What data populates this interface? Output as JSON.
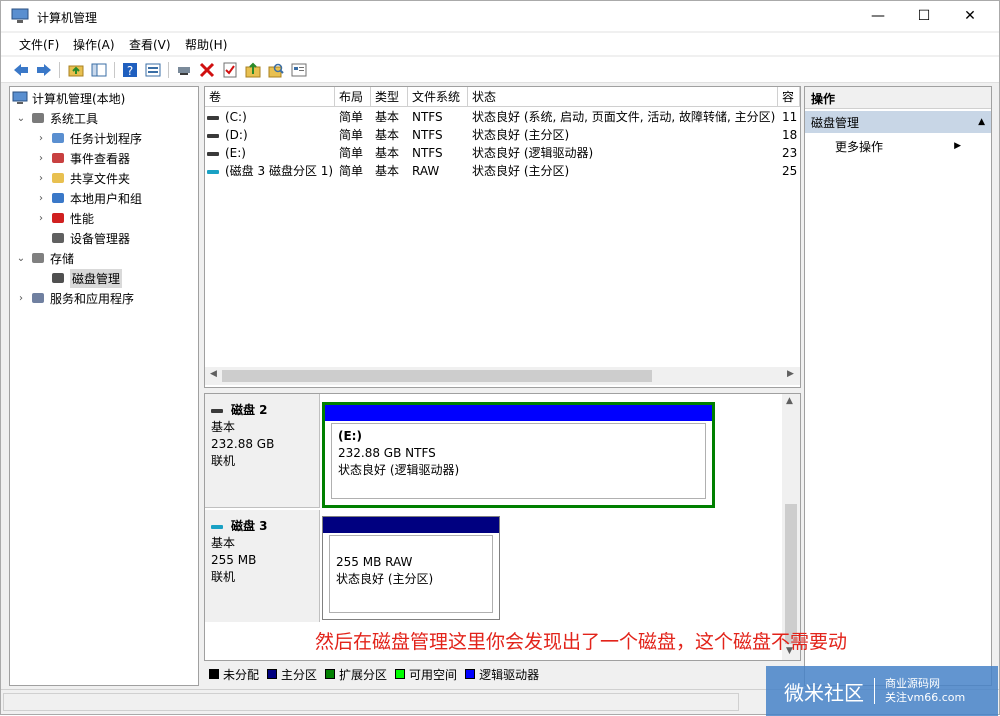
{
  "window": {
    "title": "计算机管理",
    "controls": {
      "minimize": "—",
      "maximize": "☐",
      "close": "✕"
    }
  },
  "menu": [
    "文件(F)",
    "操作(A)",
    "查看(V)",
    "帮助(H)"
  ],
  "toolbar": [
    "back-icon",
    "forward-icon",
    "up-folder-icon",
    "show-tree-icon",
    "help-icon",
    "properties-icon",
    "connect-icon",
    "delete-icon",
    "check-icon",
    "open-folder-icon",
    "search-folder-icon",
    "console-icon"
  ],
  "tree": {
    "root": "计算机管理(本地)",
    "items": [
      {
        "label": "系统工具",
        "level": 1,
        "expander": "⌄",
        "icon": "tools-icon"
      },
      {
        "label": "任务计划程序",
        "level": 2,
        "expander": "›",
        "icon": "clock-icon"
      },
      {
        "label": "事件查看器",
        "level": 2,
        "expander": "›",
        "icon": "event-viewer-icon"
      },
      {
        "label": "共享文件夹",
        "level": 2,
        "expander": "›",
        "icon": "shared-folder-icon"
      },
      {
        "label": "本地用户和组",
        "level": 2,
        "expander": "›",
        "icon": "users-icon"
      },
      {
        "label": "性能",
        "level": 2,
        "expander": "›",
        "icon": "performance-icon"
      },
      {
        "label": "设备管理器",
        "level": 2,
        "expander": "",
        "icon": "device-manager-icon"
      },
      {
        "label": "存储",
        "level": 1,
        "expander": "⌄",
        "icon": "storage-icon"
      },
      {
        "label": "磁盘管理",
        "level": 2,
        "expander": "",
        "icon": "disk-management-icon",
        "selected": true
      },
      {
        "label": "服务和应用程序",
        "level": 1,
        "expander": "›",
        "icon": "services-icon"
      }
    ]
  },
  "volumes": {
    "columns": [
      "卷",
      "布局",
      "类型",
      "文件系统",
      "状态",
      "容"
    ],
    "rows": [
      {
        "vol": "(C:)",
        "layout": "简单",
        "type": "基本",
        "fs": "NTFS",
        "status": "状态良好 (系统, 启动, 页面文件, 活动, 故障转储, 主分区)",
        "cap": "11",
        "usb": false
      },
      {
        "vol": "(D:)",
        "layout": "简单",
        "type": "基本",
        "fs": "NTFS",
        "status": "状态良好 (主分区)",
        "cap": "18",
        "usb": false
      },
      {
        "vol": "(E:)",
        "layout": "简单",
        "type": "基本",
        "fs": "NTFS",
        "status": "状态良好 (逻辑驱动器)",
        "cap": "23",
        "usb": false
      },
      {
        "vol": "(磁盘 3 磁盘分区 1)",
        "layout": "简单",
        "type": "基本",
        "fs": "RAW",
        "status": "状态良好 (主分区)",
        "cap": "25",
        "usb": true
      }
    ]
  },
  "disks": [
    {
      "name": "磁盘 2",
      "kind": "基本",
      "size": "232.88 GB",
      "state": "联机",
      "part_label": "(E:)",
      "part_size": "232.88 GB NTFS",
      "part_status": "状态良好 (逻辑驱动器)",
      "bar_color": "#0000ff"
    },
    {
      "name": "磁盘 3",
      "kind": "基本",
      "size": "255 MB",
      "state": "联机",
      "part_label": "",
      "part_size": "255 MB RAW",
      "part_status": "状态良好 (主分区)",
      "bar_color": "#000080"
    }
  ],
  "legend": [
    {
      "label": "未分配",
      "color": "#000000"
    },
    {
      "label": "主分区",
      "color": "#000080"
    },
    {
      "label": "扩展分区",
      "color": "#008000"
    },
    {
      "label": "可用空间",
      "color": "#00ff00"
    },
    {
      "label": "逻辑驱动器",
      "color": "#0000ff"
    }
  ],
  "actions": {
    "header": "操作",
    "group": "磁盘管理",
    "more": "更多操作"
  },
  "caption": "然后在磁盘管理这里你会发现出了一个磁盘，这个磁盘不需要动",
  "watermark": {
    "brand": "微米社区",
    "line1": "商业源码网",
    "line2": "关注vm66.com"
  }
}
